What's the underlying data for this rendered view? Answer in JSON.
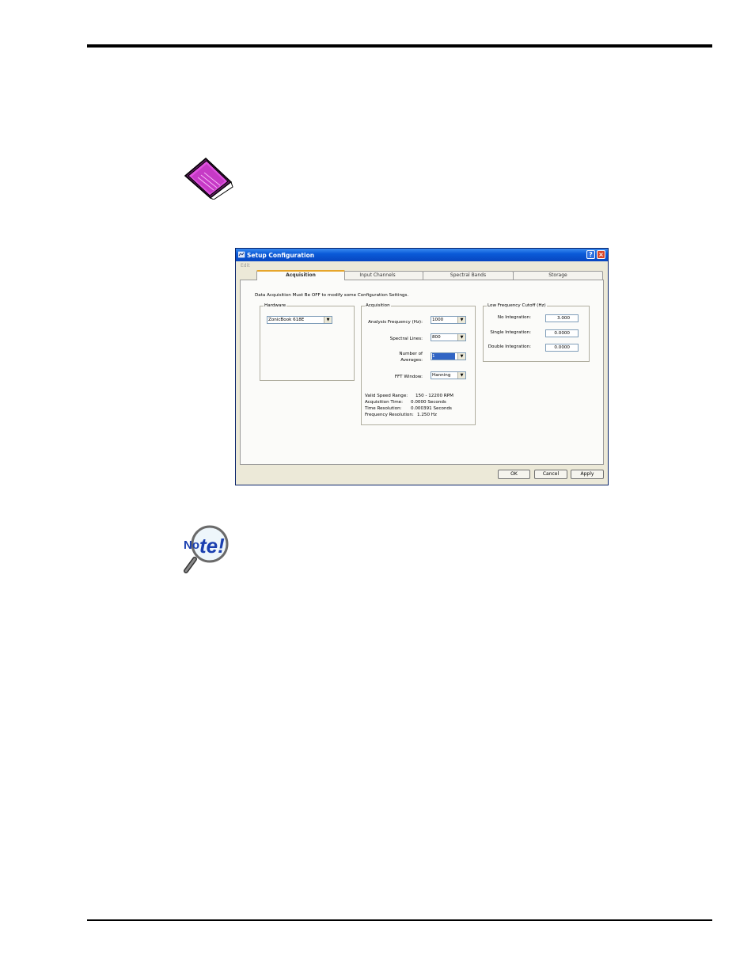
{
  "note_icon_text": {
    "left": "No",
    "right": "te!"
  },
  "dialog": {
    "title": "Setup Configuration",
    "help_button": "?",
    "close_button": "×",
    "menu_edit": "Edit",
    "tabs": [
      "Acquisition",
      "Input Channels",
      "Spectral Bands",
      "Storage"
    ],
    "active_tab": "Acquisition",
    "warning": "Data Acquisition Must Be OFF to modify some Configuration Settings.",
    "hardware": {
      "title": "Hardware",
      "device": "ZonicBook 618E"
    },
    "acquisition": {
      "title": "Acquisition",
      "analysis_frequency_label": "Analysis Frequency (Hz):",
      "analysis_frequency": "1000",
      "spectral_lines_label": "Spectral Lines:",
      "spectral_lines": "800",
      "number_of_averages_label_1": "Number of",
      "number_of_averages_label_2": "Averages:",
      "number_of_averages": "1",
      "fft_window_label": "FFT Window:",
      "fft_window": "Hanning",
      "valid_speed_range_label": "Valid Speed Range:",
      "valid_speed_range": "150 - 12200 RPM",
      "acquisition_time_label": "Acquisition Time:",
      "acquisition_time": "0.0000 Seconds",
      "time_resolution_label": "Time Resolution:",
      "time_resolution": "0.000391 Seconds",
      "frequency_resolution_label": "Frequency Resolution:",
      "frequency_resolution": "1.250 Hz"
    },
    "low_frequency_cutoff": {
      "title": "Low Frequency Cutoff  (Hz)",
      "no_integration_label": "No Integration:",
      "no_integration": "3.000",
      "single_integration_label": "Single Integration:",
      "single_integration": "0.0000",
      "double_integration_label": "Double Integration:",
      "double_integration": "0.0000"
    },
    "buttons": {
      "ok": "OK",
      "cancel": "Cancel",
      "apply": "Apply"
    }
  }
}
